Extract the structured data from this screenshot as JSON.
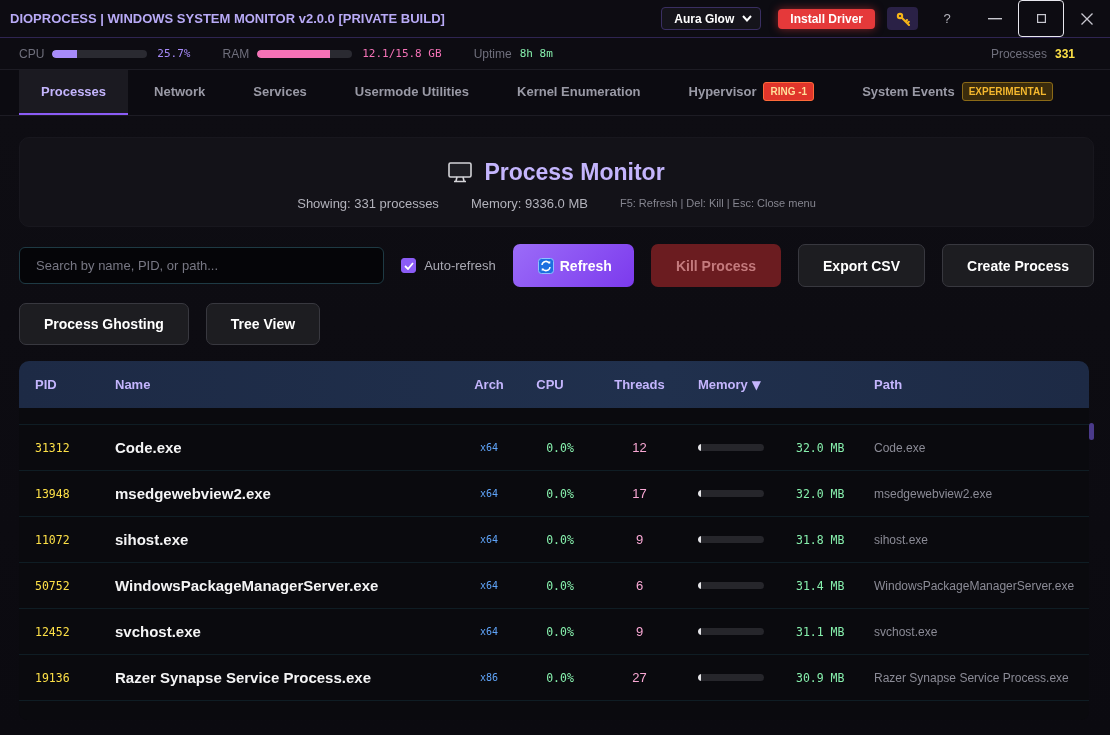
{
  "title_bar": {
    "title": "DIOPROCESS | WINDOWS SYSTEM MONITOR v2.0.0 [PRIVATE BUILD]",
    "theme_select": {
      "value": "Aura Glow"
    },
    "install_button": {
      "label": "Install Driver"
    },
    "help_button": {
      "label": "?"
    },
    "window_controls": [
      {
        "kind": "minimize",
        "focused": false
      },
      {
        "kind": "maximize",
        "focused": true
      },
      {
        "kind": "close",
        "focused": false
      }
    ]
  },
  "stats": [
    {
      "kind": "meter",
      "label": "CPU",
      "level": 0.257,
      "reading": "25.7%",
      "color": "#a78bfa"
    },
    {
      "kind": "meter",
      "label": "RAM",
      "level": 0.766,
      "reading": "12.1/15.8 GB",
      "color": "#f472b6"
    },
    {
      "kind": "value",
      "label": "Uptime",
      "value": "8h 8m",
      "color": "#86efac"
    },
    {
      "kind": "value",
      "label": "Processes",
      "value": "331",
      "color": "#fde047"
    }
  ],
  "tabs": [
    {
      "label": "Processes",
      "selected": true
    },
    {
      "label": "Network",
      "selected": false
    },
    {
      "label": "Services",
      "selected": false
    },
    {
      "label": "Usermode Utilities",
      "selected": false
    },
    {
      "label": "Kernel Enumeration",
      "selected": false
    },
    {
      "label": "Hypervisor",
      "selected": false,
      "badge": {
        "text": "RING -1",
        "kind": "danger"
      }
    },
    {
      "label": "System Events",
      "selected": false,
      "badge": {
        "text": "EXPERIMENTAL",
        "kind": "warning"
      }
    }
  ],
  "header": {
    "title": "Process Monitor",
    "facts": [
      "Showing: 331 processes",
      "Memory: 9336.0 MB"
    ],
    "shortcuts": "F5: Refresh | Del: Kill | Esc: Close menu"
  },
  "toolbar": {
    "search": {
      "placeholder": "Search by name, PID, or path..."
    },
    "auto_refresh": {
      "label": "Auto-refresh",
      "checked": true
    },
    "actions": [
      {
        "label": "Refresh",
        "kind": "primary",
        "disabled": false
      },
      {
        "label": "Kill Process",
        "kind": "danger",
        "disabled": true
      },
      {
        "label": "Export CSV",
        "kind": "secondary",
        "disabled": false
      },
      {
        "label": "Create Process",
        "kind": "secondary",
        "disabled": false
      }
    ],
    "more_actions": [
      {
        "label": "Process Ghosting",
        "kind": "secondary",
        "disabled": false
      },
      {
        "label": "Tree View",
        "kind": "secondary",
        "disabled": false
      }
    ]
  },
  "table": {
    "columns": [
      {
        "label": "PID"
      },
      {
        "label": "Name"
      },
      {
        "label": "Arch"
      },
      {
        "label": "CPU"
      },
      {
        "label": "Threads"
      },
      {
        "label": "Memory",
        "sort_mark": "▼"
      },
      {
        "label": "Path"
      }
    ],
    "rows": [
      {
        "pid": "31312",
        "name": "Code.exe",
        "arch": "x64",
        "cpu": "0.0%",
        "threads": "12",
        "level": 0.05,
        "memory": "32.0 MB",
        "path": "Code.exe"
      },
      {
        "pid": "13948",
        "name": "msedgewebview2.exe",
        "arch": "x64",
        "cpu": "0.0%",
        "threads": "17",
        "level": 0.05,
        "memory": "32.0 MB",
        "path": "msedgewebview2.exe"
      },
      {
        "pid": "11072",
        "name": "sihost.exe",
        "arch": "x64",
        "cpu": "0.0%",
        "threads": "9",
        "level": 0.05,
        "memory": "31.8 MB",
        "path": "sihost.exe"
      },
      {
        "pid": "50752",
        "name": "WindowsPackageManagerServer.exe",
        "arch": "x64",
        "cpu": "0.0%",
        "threads": "6",
        "level": 0.05,
        "memory": "31.4 MB",
        "path": "WindowsPackageManagerServer.exe"
      },
      {
        "pid": "12452",
        "name": "svchost.exe",
        "arch": "x64",
        "cpu": "0.0%",
        "threads": "9",
        "level": 0.05,
        "memory": "31.1 MB",
        "path": "svchost.exe"
      },
      {
        "pid": "19136",
        "name": "Razer Synapse Service Process.exe",
        "arch": "x86",
        "cpu": "0.0%",
        "threads": "27",
        "level": 0.05,
        "memory": "30.9 MB",
        "path": "Razer Synapse Service Process.exe"
      }
    ]
  }
}
